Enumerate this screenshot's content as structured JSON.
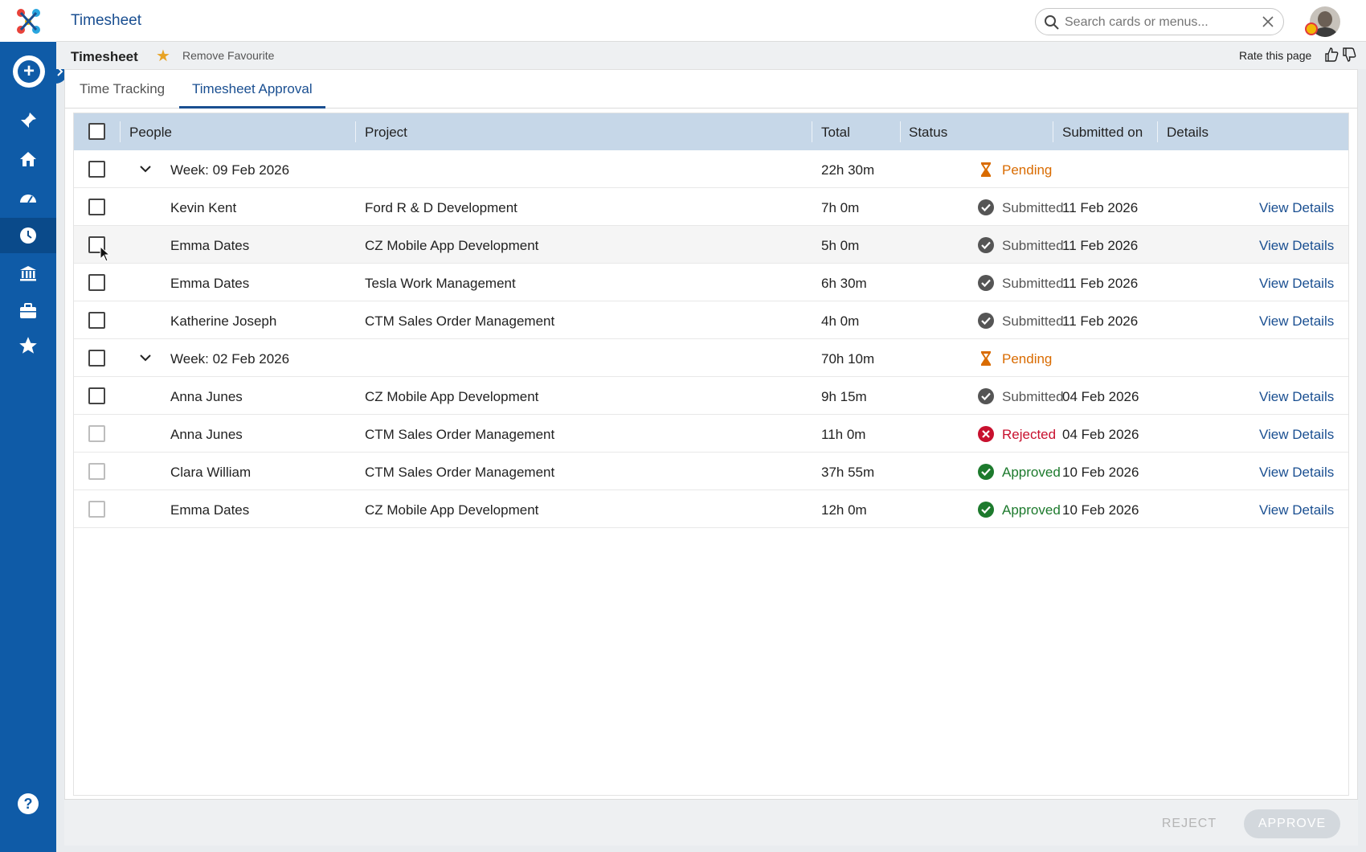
{
  "app": {
    "title": "Timesheet",
    "search_placeholder": "Search cards or menus..."
  },
  "page": {
    "title": "Timesheet",
    "favourite_label": "Remove Favourite",
    "rate_label": "Rate this page"
  },
  "tabs": [
    {
      "label": "Time Tracking",
      "active": false
    },
    {
      "label": "Timesheet Approval",
      "active": true
    }
  ],
  "table": {
    "headers": {
      "people": "People",
      "project": "Project",
      "total": "Total",
      "status": "Status",
      "submitted_on": "Submitted on",
      "details": "Details"
    },
    "rows": [
      {
        "type": "week",
        "people": "Week: 09 Feb 2026",
        "project": "",
        "total": "22h 30m",
        "status": "Pending",
        "submitted_on": "",
        "details": ""
      },
      {
        "type": "entry",
        "people": "Kevin Kent",
        "project": "Ford R & D Development",
        "total": "7h 0m",
        "status": "Submitted",
        "submitted_on": "11 Feb 2026",
        "details": "View Details"
      },
      {
        "type": "entry",
        "people": "Emma Dates",
        "project": "CZ Mobile App Development",
        "total": "5h 0m",
        "status": "Submitted",
        "submitted_on": "11 Feb 2026",
        "details": "View Details"
      },
      {
        "type": "entry",
        "people": "Emma Dates",
        "project": "Tesla Work Management",
        "total": "6h 30m",
        "status": "Submitted",
        "submitted_on": "11 Feb 2026",
        "details": "View Details"
      },
      {
        "type": "entry",
        "people": "Katherine Joseph",
        "project": "CTM Sales Order Management",
        "total": "4h 0m",
        "status": "Submitted",
        "submitted_on": "11 Feb 2026",
        "details": "View Details"
      },
      {
        "type": "week",
        "people": "Week: 02 Feb 2026",
        "project": "",
        "total": "70h 10m",
        "status": "Pending",
        "submitted_on": "",
        "details": ""
      },
      {
        "type": "entry",
        "people": "Anna Junes",
        "project": "CZ Mobile App Development",
        "total": "9h 15m",
        "status": "Submitted",
        "submitted_on": "04 Feb 2026",
        "details": "View Details"
      },
      {
        "type": "entry",
        "people": "Anna Junes",
        "project": "CTM Sales Order Management",
        "total": "11h 0m",
        "status": "Rejected",
        "submitted_on": "04 Feb 2026",
        "details": "View Details"
      },
      {
        "type": "entry",
        "people": "Clara William",
        "project": "CTM Sales Order Management",
        "total": "37h 55m",
        "status": "Approved",
        "submitted_on": "10 Feb 2026",
        "details": "View Details"
      },
      {
        "type": "entry",
        "people": "Emma Dates",
        "project": "CZ Mobile App Development",
        "total": "12h 0m",
        "status": "Approved",
        "submitted_on": "10 Feb 2026",
        "details": "View Details"
      }
    ]
  },
  "footer": {
    "reject_label": "REJECT",
    "approve_label": "APPROVE"
  },
  "colors": {
    "brand": "#0f5ba7",
    "header_row": "#c6d7e8",
    "pending": "#d96b00",
    "rejected": "#c8102e",
    "approved": "#1d7a2d"
  }
}
